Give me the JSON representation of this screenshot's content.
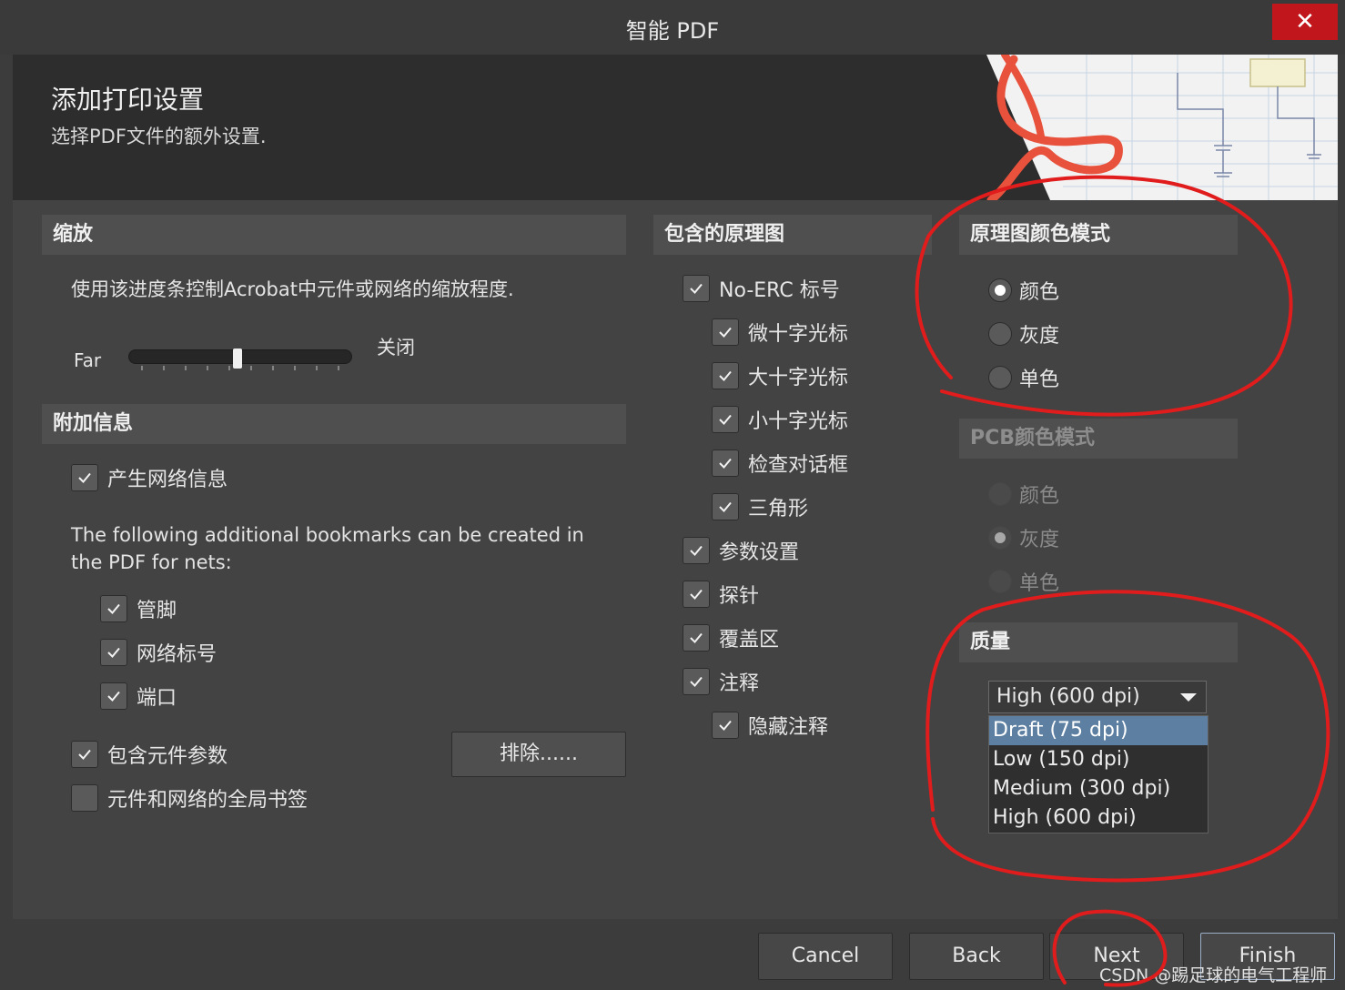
{
  "window": {
    "title": "智能 PDF",
    "close_glyph": "✕"
  },
  "header": {
    "title": "添加打印设置",
    "subtitle": "选择PDF文件的额外设置."
  },
  "zoom": {
    "title": "缩放",
    "description": "使用该进度条控制Acrobat中元件或网络的缩放程度.",
    "min_label": "Far",
    "max_label": "关闭",
    "slider_value": 0.5
  },
  "additional": {
    "title": "附加信息",
    "generate_net_info": {
      "label": "产生网络信息",
      "checked": true
    },
    "bookmarks_text": "The following additional bookmarks can be created in the PDF for nets:",
    "bookmarks": [
      {
        "label": "管脚",
        "checked": true
      },
      {
        "label": "网络标号",
        "checked": true
      },
      {
        "label": "端口",
        "checked": true
      }
    ],
    "include_params": {
      "label": "包含元件参数",
      "checked": true
    },
    "exclude_button": "排除......",
    "global_bookmarks": {
      "label": "元件和网络的全局书签",
      "checked": false
    }
  },
  "schematics": {
    "title": "包含的原理图",
    "items": [
      {
        "label": "No-ERC 标号",
        "checked": true
      },
      {
        "label": "微十字光标",
        "checked": true
      },
      {
        "label": "大十字光标",
        "checked": true
      },
      {
        "label": "小十字光标",
        "checked": true
      },
      {
        "label": "检查对话框",
        "checked": true
      },
      {
        "label": "三角形",
        "checked": true
      },
      {
        "label": "参数设置",
        "checked": true
      },
      {
        "label": "探针",
        "checked": true
      },
      {
        "label": "覆盖区",
        "checked": true
      },
      {
        "label": "注释",
        "checked": true
      },
      {
        "label": "隐藏注释",
        "checked": true
      }
    ]
  },
  "sch_color_mode": {
    "title": "原理图颜色模式",
    "options": [
      {
        "label": "颜色",
        "selected": true
      },
      {
        "label": "灰度",
        "selected": false
      },
      {
        "label": "单色",
        "selected": false
      }
    ]
  },
  "pcb_color_mode": {
    "title": "PCB颜色模式",
    "options": [
      {
        "label": "颜色",
        "selected": false
      },
      {
        "label": "灰度",
        "selected": true
      },
      {
        "label": "单色",
        "selected": false
      }
    ]
  },
  "quality": {
    "title": "质量",
    "selected": "High (600 dpi)",
    "options": [
      "Draft (75 dpi)",
      "Low (150 dpi)",
      "Medium (300 dpi)",
      "High (600 dpi)"
    ]
  },
  "footer": {
    "cancel": "Cancel",
    "back": "Back",
    "next": "Next",
    "finish": "Finish",
    "watermark": "CSDN @踢足球的电气工程师"
  },
  "colors": {
    "annotation_red": "#e01c1c",
    "close_red": "#c1161c",
    "selection_blue": "#5d7fa2",
    "acrobat_red": "#e8513c"
  }
}
